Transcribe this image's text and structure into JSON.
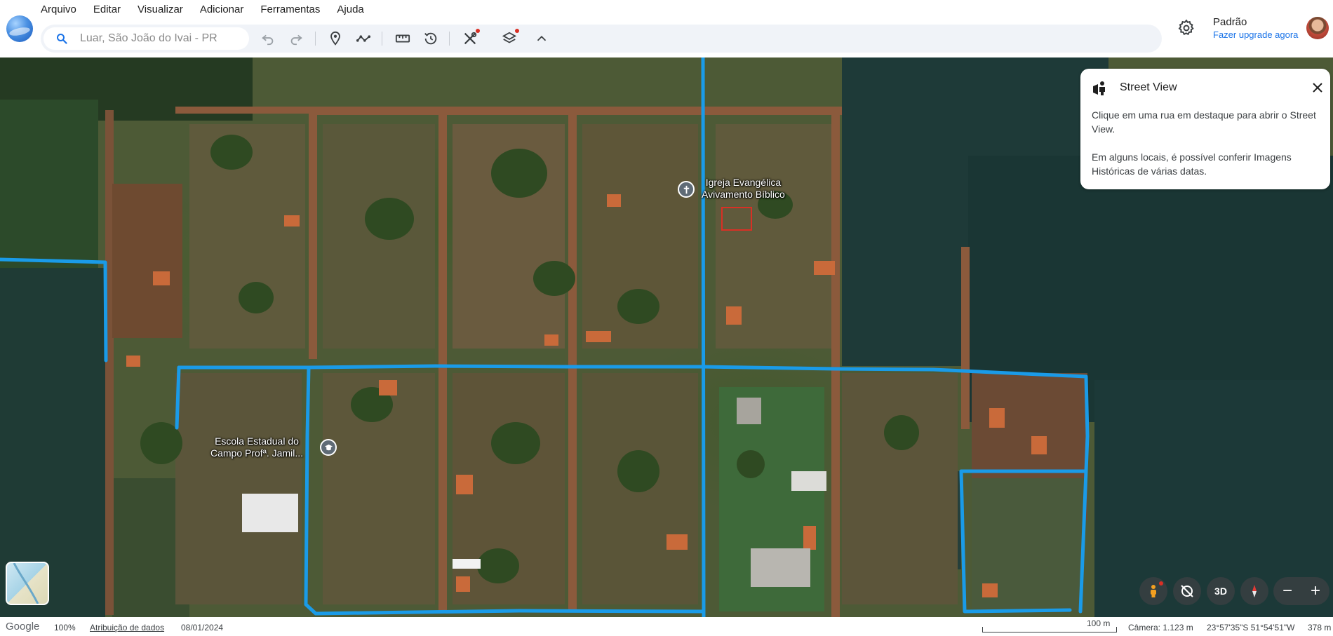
{
  "menu": {
    "items": [
      "Arquivo",
      "Editar",
      "Visualizar",
      "Adicionar",
      "Ferramentas",
      "Ajuda"
    ]
  },
  "search": {
    "placeholder": "Luar, São João do Ivai - PR"
  },
  "toolbar": {
    "icons": [
      "undo-icon",
      "redo-icon",
      "placemark-icon",
      "path-icon",
      "ruler-icon",
      "history-icon",
      "tools-icon",
      "layers-icon",
      "chevron-up-icon"
    ]
  },
  "profile": {
    "name": "Padrão",
    "upgrade": "Fazer upgrade agora"
  },
  "map": {
    "labels": {
      "church": "Igreja Evangélica\nAvivamento Bíblico",
      "church_line1": "Igreja Evangélica",
      "church_line2": "Avivamento Bíblico",
      "school_line1": "Escola Estadual do",
      "school_line2": "Campo Profª. Jamil..."
    },
    "street_color": "#1a9be8"
  },
  "street_view": {
    "title": "Street View",
    "text1": "Clique em uma rua em destaque para abrir o Street View.",
    "text2": "Em alguns locais, é possível conferir Imagens Históricas de várias datas."
  },
  "controls": {
    "three_d": "3D",
    "zoom_out": "−",
    "zoom_in": "+"
  },
  "status": {
    "brand": "Google",
    "zoom": "100%",
    "attribution": "Atribuição de dados",
    "date": "08/01/2024",
    "scale": "100 m",
    "camera": "Câmera: 1.123 m",
    "coords": "23°57'35\"S 51°54'51\"W",
    "elevation": "378 m"
  }
}
